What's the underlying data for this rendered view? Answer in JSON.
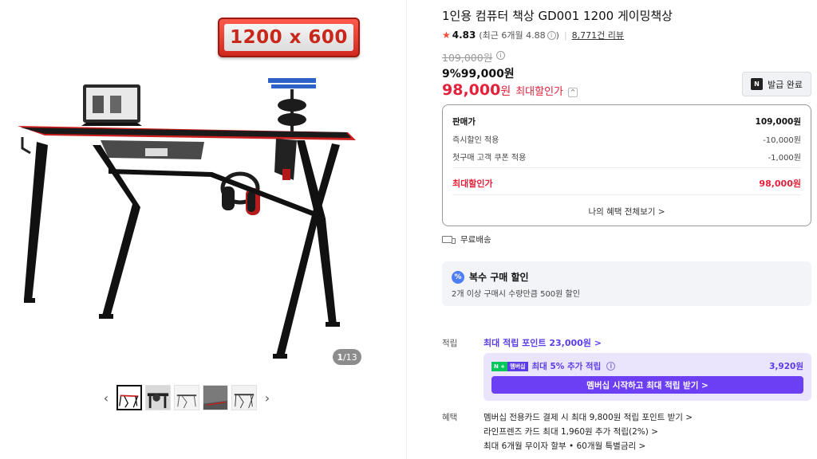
{
  "gallery": {
    "size_badge": "1200 x 600",
    "counter_current": "1",
    "counter_total": "/13",
    "thumbnails": [
      "thumb-1",
      "thumb-2",
      "thumb-3",
      "thumb-4",
      "thumb-5"
    ],
    "prev_icon": "chevron-left-icon",
    "next_icon": "chevron-right-icon"
  },
  "product": {
    "title": "1인용 컴퓨터 책상 GD001 1200 게이밍책상",
    "rating": "4.83",
    "rating_recent": "(최근 6개월 4.88",
    "rating_recent_close": ")",
    "review_count": "8,771건 리뷰",
    "original_price": "109,000원",
    "discount_rate": "9%",
    "discount_price": "99,000원",
    "final_price": "98,000",
    "final_won": "원",
    "final_label": "최대할인가",
    "coupon_button": "발급 완료",
    "coupon_icon_text": "N"
  },
  "price_box": {
    "rows": [
      {
        "label": "판매가",
        "value": "109,000원"
      },
      {
        "label": "즉시할인 적용",
        "value": "-10,000원"
      },
      {
        "label": "첫구매 고객 쿠폰 적용",
        "value": "-1,000원"
      },
      {
        "label": "최대할인가",
        "value": "98,000원"
      }
    ],
    "more": "나의 혜택 전체보기 >"
  },
  "shipping": {
    "label": "무료배송"
  },
  "bulk": {
    "icon_text": "%",
    "title": "복수 구매 할인",
    "desc": "2개 이상 구매시 수량만큼 500원 할인"
  },
  "points": {
    "label": "적립",
    "max": "최대 적립 포인트 23,000원 >",
    "member_badge_n": "N +",
    "member_badge_p": "멤버십",
    "member_text": "최대 5% 추가 적립",
    "member_amount": "3,920원",
    "member_button": "멤버십 시작하고 최대 적립 받기 >"
  },
  "benefits": {
    "label": "혜택",
    "items": [
      "멤버십 전용카드 결제 시 최대 9,800원 적립 포인트 받기 >",
      "라인프렌즈 카드 최대 1,960원 추가 적립(2%) >",
      "최대 6개월 무이자 할부 • 60개월 특별금리 >"
    ]
  },
  "colors": {
    "accent_red": "#e3213b",
    "point_purple": "#5b3de8",
    "naver_green": "#03c75a"
  }
}
